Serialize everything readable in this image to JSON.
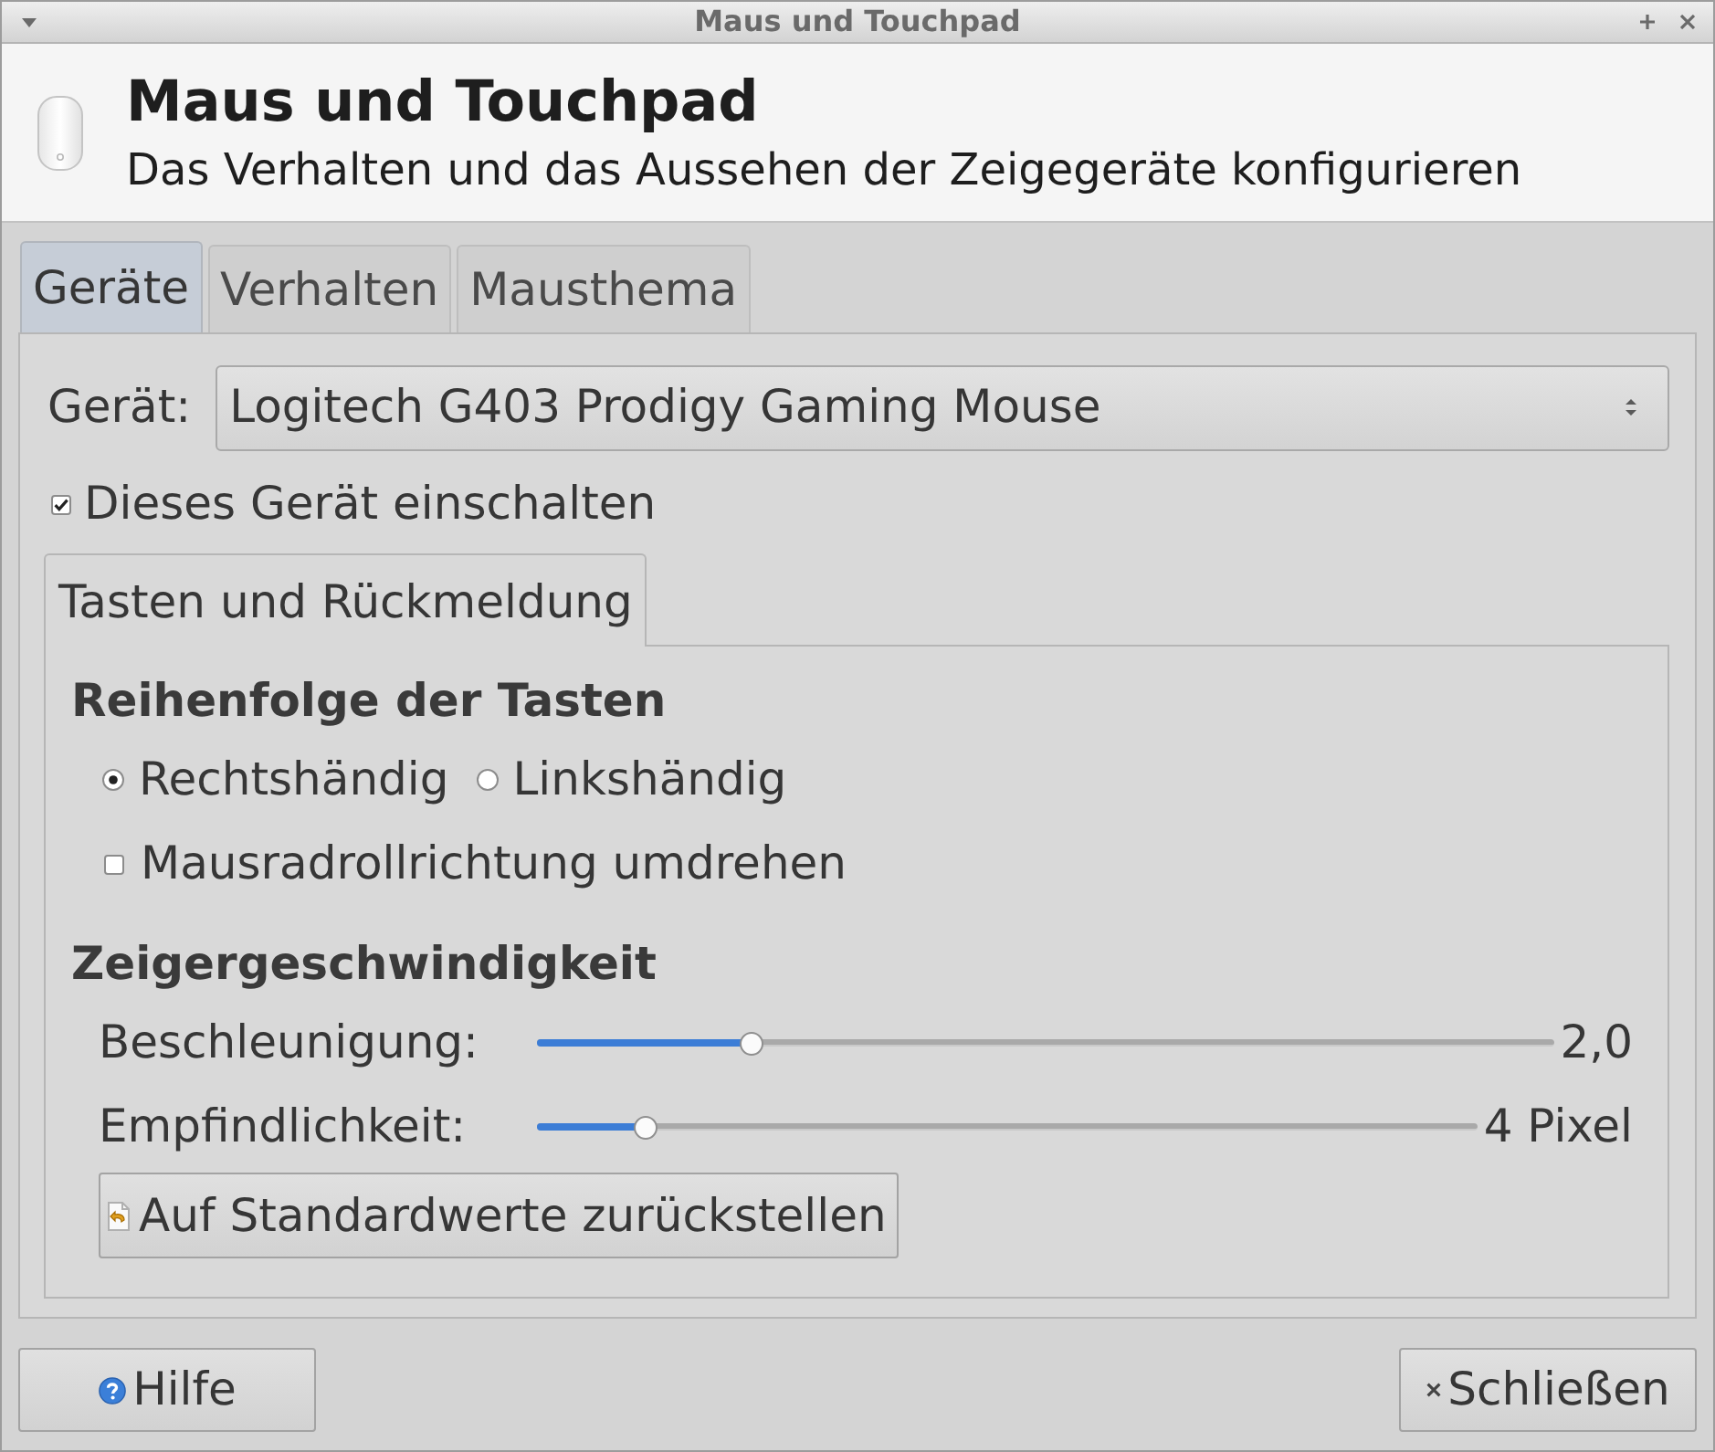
{
  "window": {
    "title": "Maus und Touchpad"
  },
  "header": {
    "title": "Maus und Touchpad",
    "subtitle": "Das Verhalten und das Aussehen der Zeigegeräte konfigurieren"
  },
  "tabs": [
    {
      "label": "Geräte",
      "selected": true
    },
    {
      "label": "Verhalten",
      "selected": false
    },
    {
      "label": "Mausthema",
      "selected": false
    }
  ],
  "device": {
    "label": "Gerät:",
    "value": "Logitech G403 Prodigy Gaming Mouse"
  },
  "enable_device": {
    "label": "Dieses Gerät einschalten",
    "checked": true
  },
  "subtabs": [
    {
      "label": "Tasten und Rückmeldung",
      "selected": true
    }
  ],
  "sections": [
    {
      "title": "Reihenfolge der Tasten",
      "controls": [
        {
          "kind": "radio_group",
          "options": [
            {
              "label": "Rechtshändig",
              "selected": true
            },
            {
              "label": "Linkshändig",
              "selected": false
            }
          ]
        },
        {
          "kind": "checkbox",
          "label": "Mausradrollrichtung umdrehen",
          "checked": false
        }
      ]
    },
    {
      "title": "Zeigergeschwindigkeit",
      "controls": [
        {
          "kind": "slider",
          "label": "Beschleunigung:",
          "level": 0.21,
          "reading": "2,0"
        },
        {
          "kind": "slider",
          "label": "Empfindlichkeit:",
          "level": 0.115,
          "reading": "4 Pixel"
        },
        {
          "kind": "button",
          "label": "Auf Standardwerte zurückstellen"
        }
      ]
    }
  ],
  "buttons": [
    {
      "kind": "help",
      "label": "Hilfe"
    },
    {
      "kind": "close",
      "label": "Schließen"
    }
  ]
}
